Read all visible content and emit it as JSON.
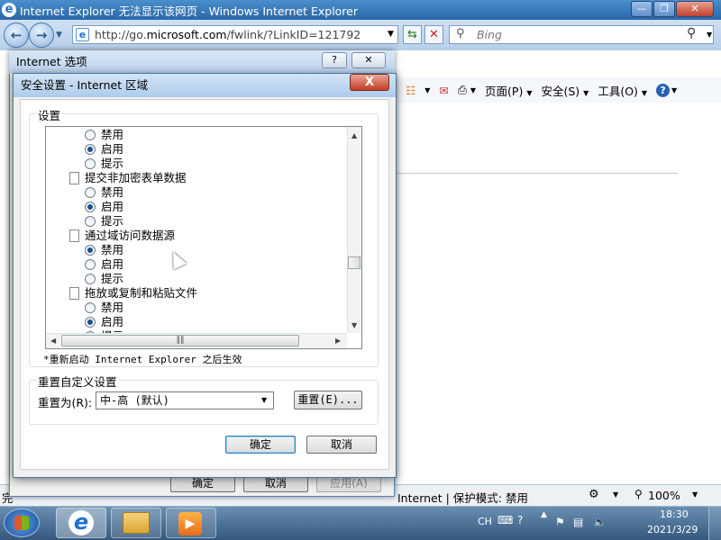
{
  "ie": {
    "title": "Internet Explorer 无法显示该网页 - Windows Internet Explorer",
    "address_url": "http://go.microsoft.com/fwlink/?LinkID=121792",
    "address_prefix": "http://go.",
    "address_domain": "microsoft.com",
    "address_rest": "/fwlink/?LinkID=121792",
    "search_placeholder": "Bing",
    "command_page": "页面(P)",
    "command_safety": "安全(S)",
    "command_tools": "工具(O)",
    "status_left": "完",
    "status_zone": "Internet | 保护模式: 禁用",
    "zoom": "100%"
  },
  "internet_options": {
    "title": "Internet 选项",
    "help_btn": "?",
    "ok": "确定",
    "cancel": "取消",
    "apply": "应用(A)"
  },
  "security_settings": {
    "title": "安全设置 - Internet 区域",
    "close": "X",
    "settings_label": "设置",
    "tree": {
      "opt_disable": "禁用",
      "opt_enable": "启用",
      "opt_prompt": "提示",
      "item_submit": "提交非加密表单数据",
      "item_cross_domain": "通过域访问数据源",
      "item_drag_drop": "拖放或复制和粘贴文件"
    },
    "restart_note": "*重新启动 Internet Explorer 之后生效",
    "reset_group_label": "重置自定义设置",
    "reset_to_label": "重置为(R):",
    "reset_level": "中-高 (默认)",
    "reset_button": "重置(E)...",
    "ok": "确定",
    "cancel": "取消"
  },
  "taskbar": {
    "lang": "CH",
    "time": "18:30",
    "date": "2021/3/29"
  }
}
